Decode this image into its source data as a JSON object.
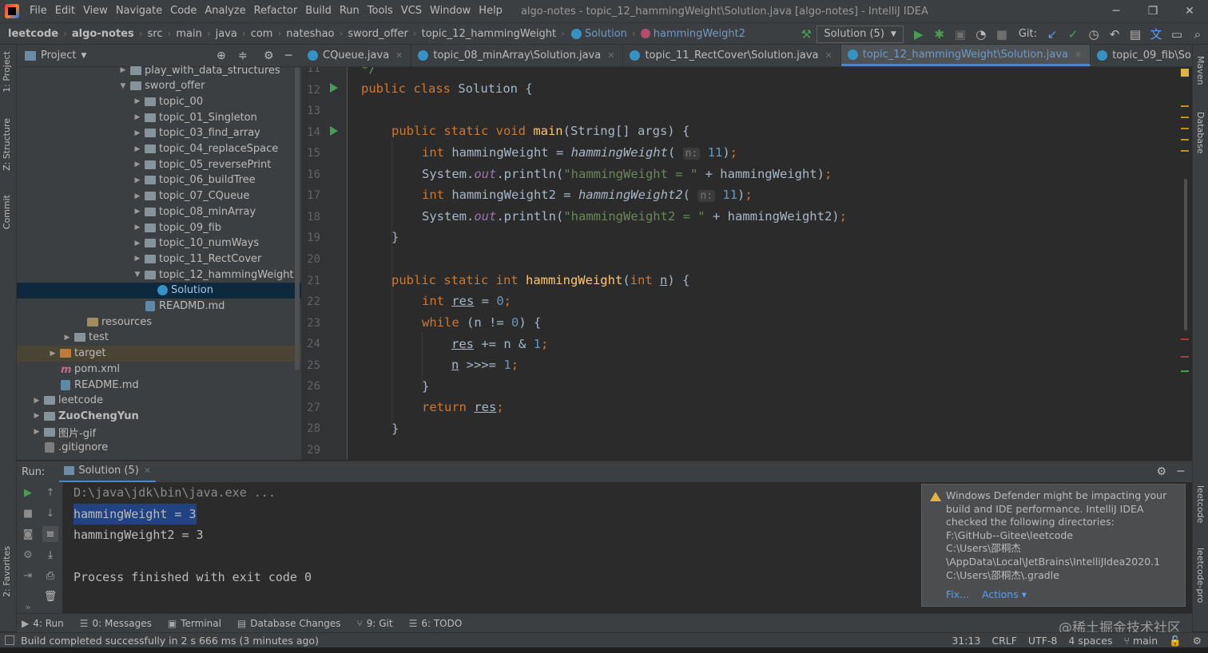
{
  "menubar": {
    "items": [
      "File",
      "Edit",
      "View",
      "Navigate",
      "Code",
      "Analyze",
      "Refactor",
      "Build",
      "Run",
      "Tools",
      "VCS",
      "Window",
      "Help"
    ],
    "title": "algo-notes - topic_12_hammingWeight\\Solution.java [algo-notes] - IntelliJ IDEA"
  },
  "breadcrumbs": [
    "leetcode",
    "algo-notes",
    "src",
    "main",
    "java",
    "com",
    "nateshao",
    "sword_offer",
    "topic_12_hammingWeight",
    "Solution",
    "hammingWeight2"
  ],
  "toolbar": {
    "run_config": "Solution (5)",
    "git_label": "Git:"
  },
  "left_stripe": {
    "project": "1: Project",
    "structure": "Z: Structure",
    "commit": "Commit",
    "favorites": "2: Favorites"
  },
  "right_stripe": {
    "maven": "Maven",
    "database": "Database",
    "leetcode": "leetcode",
    "leetcode_pro": "leetcode-pro"
  },
  "project": {
    "header": "Project",
    "tree": [
      {
        "label": "play_with_data_structures",
        "arrow": "▶",
        "icon": "folder"
      },
      {
        "label": "sword_offer",
        "arrow": "▼",
        "icon": "folder"
      },
      {
        "label": "topic_00",
        "arrow": "▶",
        "icon": "folder"
      },
      {
        "label": "topic_01_Singleton",
        "arrow": "▶",
        "icon": "folder"
      },
      {
        "label": "topic_03_find_array",
        "arrow": "▶",
        "icon": "folder"
      },
      {
        "label": "topic_04_replaceSpace",
        "arrow": "▶",
        "icon": "folder"
      },
      {
        "label": "topic_05_reversePrint",
        "arrow": "▶",
        "icon": "folder"
      },
      {
        "label": "topic_06_buildTree",
        "arrow": "▶",
        "icon": "folder"
      },
      {
        "label": "topic_07_CQueue",
        "arrow": "▶",
        "icon": "folder"
      },
      {
        "label": "topic_08_minArray",
        "arrow": "▶",
        "icon": "folder"
      },
      {
        "label": "topic_09_fib",
        "arrow": "▶",
        "icon": "folder"
      },
      {
        "label": "topic_10_numWays",
        "arrow": "▶",
        "icon": "folder"
      },
      {
        "label": "topic_11_RectCover",
        "arrow": "▶",
        "icon": "folder"
      },
      {
        "label": "topic_12_hammingWeight",
        "arrow": "▼",
        "icon": "folder"
      },
      {
        "label": "Solution",
        "arrow": "",
        "icon": "class"
      },
      {
        "label": "READMD.md",
        "arrow": "",
        "icon": "md"
      },
      {
        "label": "resources",
        "arrow": "",
        "icon": "res"
      },
      {
        "label": "test",
        "arrow": "▶",
        "icon": "folder"
      },
      {
        "label": "target",
        "arrow": "▶",
        "icon": "orange"
      },
      {
        "label": "pom.xml",
        "arrow": "",
        "icon": "maven"
      },
      {
        "label": "README.md",
        "arrow": "",
        "icon": "md"
      },
      {
        "label": "leetcode",
        "arrow": "▶",
        "icon": "folder"
      },
      {
        "label": "ZuoChengYun",
        "arrow": "▶",
        "icon": "folder"
      },
      {
        "label": "图片-gif",
        "arrow": "▶",
        "icon": "folder"
      },
      {
        "label": ".gitignore",
        "arrow": "",
        "icon": "file"
      }
    ]
  },
  "editor": {
    "tabs": [
      "CQueue.java",
      "topic_08_minArray\\Solution.java",
      "topic_11_RectCover\\Solution.java",
      "topic_12_hammingWeight\\Solution.java",
      "topic_09_fib\\Solution.java"
    ],
    "active_tab": 3,
    "line_numbers": [
      "11",
      "12",
      "13",
      "14",
      "15",
      "16",
      "17",
      "18",
      "19",
      "20",
      "21",
      "22",
      "23",
      "24",
      "25",
      "26",
      "27",
      "28",
      "29"
    ],
    "code": {
      "l11": "*/",
      "l12_a": "public class ",
      "l12_b": "Solution {",
      "l14_a": "public static void ",
      "l14_b": "main",
      "l14_c": "(String[] args) {",
      "l15_a": "int ",
      "l15_b": "hammingWeight = ",
      "l15_c": "hammingWeight",
      "l15_d": "(",
      "l15_e": "n:",
      "l15_f": "11",
      "l15_g": ")",
      "l15_h": ";",
      "l16_a": "System.",
      "l16_b": "out",
      "l16_c": ".println(",
      "l16_d": "\"hammingWeight = \"",
      "l16_e": " + hammingWeight)",
      "l16_f": ";",
      "l17_a": "int ",
      "l17_b": "hammingWeight2 = ",
      "l17_c": "hammingWeight2",
      "l17_d": "(",
      "l17_e": "n:",
      "l17_f": "11",
      "l17_g": ")",
      "l17_h": ";",
      "l18_a": "System.",
      "l18_b": "out",
      "l18_c": ".println(",
      "l18_d": "\"hammingWeight2 = \"",
      "l18_e": " + hammingWeight2)",
      "l18_f": ";",
      "l19": "}",
      "l21_a": "public static int ",
      "l21_b": "hammingWeight",
      "l21_c": "(",
      "l21_d": "int ",
      "l21_e": "n",
      "l21_f": ") {",
      "l22_a": "int ",
      "l22_b": "res",
      "l22_c": " = ",
      "l22_d": "0",
      "l22_e": ";",
      "l23_a": "while ",
      "l23_b": "(n != ",
      "l23_c": "0",
      "l23_d": ") {",
      "l24_a": "res",
      "l24_b": " += n & ",
      "l24_c": "1",
      "l24_d": ";",
      "l25_a": "n",
      "l25_b": " >>>= ",
      "l25_c": "1",
      "l25_d": ";",
      "l26": "}",
      "l27_a": "return ",
      "l27_b": "res",
      "l27_c": ";",
      "l28": "}"
    }
  },
  "run": {
    "label": "Run:",
    "tab": "Solution (5)",
    "console": [
      "D:\\java\\jdk\\bin\\java.exe ...",
      "hammingWeight = 3",
      "hammingWeight2 = 3",
      "",
      "Process finished with exit code 0"
    ]
  },
  "notification": {
    "lines": [
      "Windows Defender might be impacting your",
      "build and IDE performance. IntelliJ IDEA",
      "checked the following directories:",
      "F:\\GitHub--Gitee\\leetcode",
      "C:\\Users\\邵桐杰",
      "\\AppData\\Local\\JetBrains\\IntelliJIdea2020.1",
      "C:\\Users\\邵桐杰\\.gradle"
    ],
    "fix": "Fix...",
    "actions": "Actions ▾"
  },
  "bottom_tabs": [
    "4: Run",
    "0: Messages",
    "Terminal",
    "Database Changes",
    "9: Git",
    "6: TODO"
  ],
  "status": {
    "message": "Build completed successfully in 2 s 666 ms (3 minutes ago)",
    "position": "31:13",
    "line_sep": "CRLF",
    "encoding": "UTF-8",
    "indent": "4 spaces",
    "branch": "main"
  },
  "watermark": "@稀土掘金技术社区"
}
